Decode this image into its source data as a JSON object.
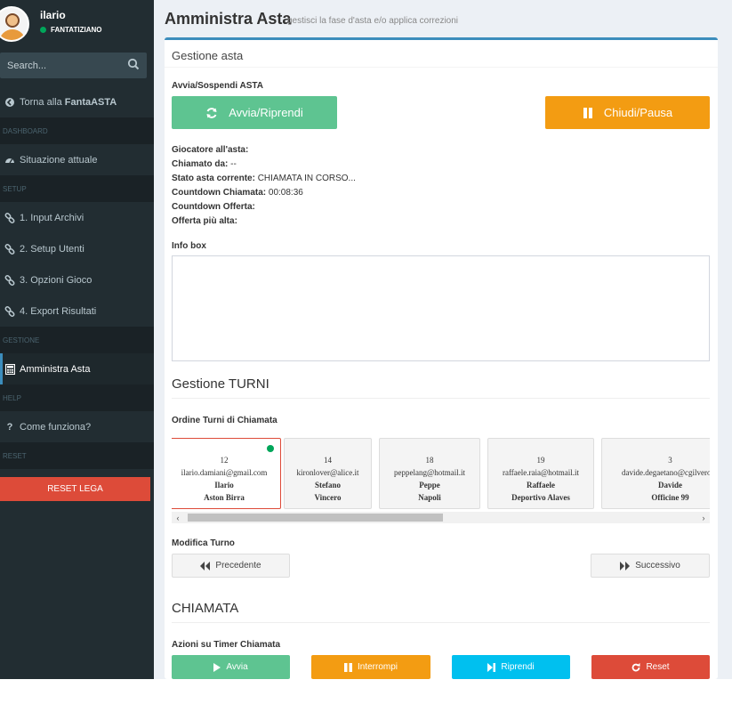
{
  "user": {
    "name": "ilario",
    "status": "FANTATIZIANO"
  },
  "search": {
    "placeholder": "Search..."
  },
  "sidebar": {
    "back": {
      "prefix": "Torna alla ",
      "bold": "FantaASTA"
    },
    "headers": {
      "dashboard": "DASHBOARD",
      "setup": "SETUP",
      "gestione": "GESTIONE",
      "help": "HELP",
      "reset": "RESET"
    },
    "items": {
      "situazione": "Situazione attuale",
      "input": "1. Input Archivi",
      "utenti": "2. Setup Utenti",
      "opzioni": "3. Opzioni Gioco",
      "export": "4. Export Risultati",
      "amministra": "Amministra Asta",
      "come": "Come funziona?"
    },
    "reset_button": "RESET LEGA"
  },
  "page": {
    "title": "Amministra Asta",
    "subtitle": "gestisci la fase d'asta e/o applica correzioni"
  },
  "asta": {
    "box_title": "Gestione asta",
    "section_label": "Avvia/Sospendi ASTA",
    "start_button": "Avvia/Riprendi",
    "pause_button": "Chiudi/Pausa",
    "status": {
      "giocatore": {
        "label": "Giocatore all'asta:",
        "value": ""
      },
      "chiamato": {
        "label": "Chiamato da:",
        "value": " --"
      },
      "stato": {
        "label": "Stato asta corrente:",
        "value": " CHIAMATA IN CORSO..."
      },
      "countdown_chiamata": {
        "label": "Countdown Chiamata:",
        "value": " 00:08:36"
      },
      "countdown_offerta": {
        "label": "Countdown Offerta:",
        "value": ""
      },
      "offerta": {
        "label": "Offerta più alta:",
        "value": ""
      }
    },
    "info_label": "Info box"
  },
  "turni": {
    "title": "Gestione TURNI",
    "order_label": "Ordine Turni di Chiamata",
    "cards": [
      {
        "num": "12",
        "email": "ilario.damiani@gmail.com",
        "name": "Ilario",
        "team": "Aston Birra"
      },
      {
        "num": "14",
        "email": "kironlover@alice.it",
        "name": "Stefano",
        "team": "Vincero"
      },
      {
        "num": "18",
        "email": "peppelang@hotmail.it",
        "name": "Peppe",
        "team": "Napoli"
      },
      {
        "num": "19",
        "email": "raffaele.raia@hotmail.it",
        "name": "Raffaele",
        "team": "Deportivo Alaves"
      },
      {
        "num": "3",
        "email": "davide.degaetano@cgilverona",
        "name": "Davide",
        "team": "Officine 99"
      }
    ],
    "modify_label": "Modifica Turno",
    "prev_button": "Precedente",
    "next_button": "Successivo"
  },
  "chiamata": {
    "title": "CHIAMATA",
    "timer_label": "Azioni su Timer Chiamata",
    "buttons": {
      "avvia": "Avvia",
      "interrompi": "Interrompi",
      "riprendi": "Riprendi",
      "reset": "Reset"
    }
  },
  "colors": {
    "sidebar_bg": "#222d32",
    "primary": "#3c8dbc",
    "success": "#5cb85c",
    "success_btn": "#5ec491",
    "warning": "#f39c12",
    "info": "#00c0ef",
    "danger": "#dd4b39"
  }
}
